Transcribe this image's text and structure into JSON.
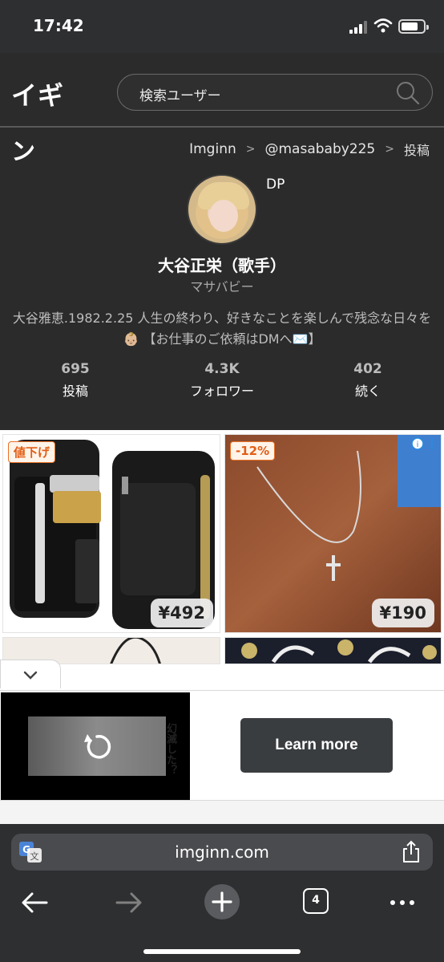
{
  "status_bar": {
    "time": "17:42"
  },
  "header": {
    "logo_line1": "イギ",
    "logo_line2": "ン",
    "search_placeholder": "検索ユーザー"
  },
  "breadcrumb": {
    "site": "Imginn",
    "user": "@masababy225",
    "current": "投稿",
    "separator": ">"
  },
  "profile": {
    "dp_label": "DP",
    "name": "大谷正栄（歌手）",
    "handle": "マサバビー",
    "bio": "大谷雅恵.1982.2.25 人生の終わり、好きなことを楽しんで残念な日々を👶🏼 【お仕事のご依頼はDMへ✉️】"
  },
  "stats": [
    {
      "value": "695",
      "label": "投稿"
    },
    {
      "value": "4.3K",
      "label": "フォロワー"
    },
    {
      "value": "402",
      "label": "続く"
    }
  ],
  "ads": {
    "product1": {
      "tag": "値下げ",
      "price": "¥492"
    },
    "product2": {
      "tag": "-12%",
      "price": "¥190"
    },
    "video_caption": "幻滅した？",
    "cta_label": "Learn more"
  },
  "browser": {
    "url": "imginn.com",
    "tab_count": "4"
  }
}
